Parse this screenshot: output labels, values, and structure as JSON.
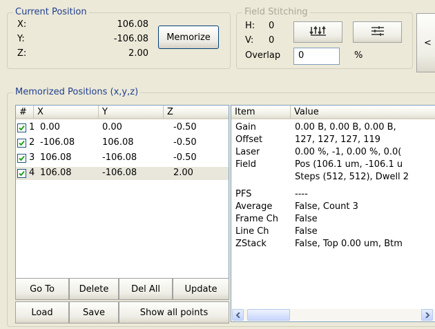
{
  "current_position": {
    "title": "Current Position",
    "x_label": "X:",
    "x_value": "106.08",
    "y_label": "Y:",
    "y_value": "-106.08",
    "z_label": "Z:",
    "z_value": "2.00",
    "memorize_label": "Memorize"
  },
  "field_stitching": {
    "title": "Field Stitching",
    "h_label": "H:",
    "h_value": "0",
    "v_label": "V:",
    "v_value": "0",
    "overlap_label": "Overlap",
    "overlap_value": "0",
    "overlap_unit": "%",
    "button1_icon": "stitch-grid-icon",
    "button2_icon": "settings-sliders-icon"
  },
  "side_button_label": "<",
  "memorized": {
    "title": "Memorized Positions (x,y,z)",
    "columns": [
      "#",
      "X",
      "Y",
      "Z"
    ],
    "rows": [
      {
        "num": "1",
        "x": "0.00",
        "y": "0.00",
        "z": "-0.50",
        "checked": true
      },
      {
        "num": "2",
        "x": "-106.08",
        "y": "106.08",
        "z": "-0.50",
        "checked": true
      },
      {
        "num": "3",
        "x": "106.08",
        "y": "-106.08",
        "z": "-0.50",
        "checked": true
      },
      {
        "num": "4",
        "x": "106.08",
        "y": "-106.08",
        "z": "2.00",
        "checked": true
      }
    ],
    "buttons": {
      "goto": "Go To",
      "delete": "Delete",
      "del_all": "Del All",
      "update": "Update",
      "load": "Load",
      "save": "Save",
      "show_all": "Show all points"
    }
  },
  "properties": {
    "columns": [
      "Item",
      "Value"
    ],
    "rows": [
      {
        "item": "Gain",
        "value": "0.00 B, 0.00 B, 0.00 B,"
      },
      {
        "item": "Offset",
        "value": "127, 127, 127, 119"
      },
      {
        "item": "Laser",
        "value": "0.00 %, -1, 0.00 %, 0.0("
      },
      {
        "item": "Field",
        "value": "Pos (106.1 um, -106.1 u"
      },
      {
        "item": "",
        "value": "Steps (512, 512), Dwell 2"
      },
      {
        "item": "PFS",
        "value": "----"
      },
      {
        "item": "Average",
        "value": "False, Count 3"
      },
      {
        "item": "Frame Ch",
        "value": "False"
      },
      {
        "item": "Line Ch",
        "value": "False"
      },
      {
        "item": "ZStack",
        "value": "False, Top 0.00 um, Btm"
      }
    ]
  }
}
